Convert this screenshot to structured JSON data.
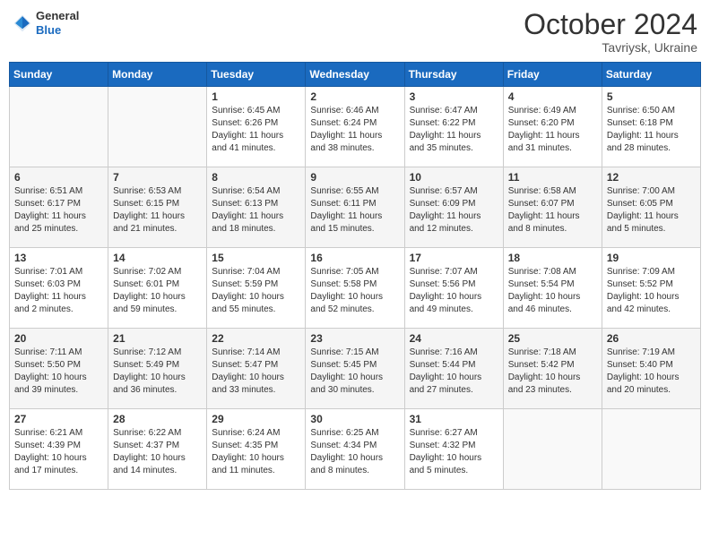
{
  "header": {
    "logo": {
      "general": "General",
      "blue": "Blue"
    },
    "month_year": "October 2024",
    "location": "Tavriysk, Ukraine"
  },
  "weekdays": [
    "Sunday",
    "Monday",
    "Tuesday",
    "Wednesday",
    "Thursday",
    "Friday",
    "Saturday"
  ],
  "weeks": [
    [
      {
        "day": null,
        "sunrise": null,
        "sunset": null,
        "daylight": null
      },
      {
        "day": null,
        "sunrise": null,
        "sunset": null,
        "daylight": null
      },
      {
        "day": "1",
        "sunrise": "Sunrise: 6:45 AM",
        "sunset": "Sunset: 6:26 PM",
        "daylight": "Daylight: 11 hours and 41 minutes."
      },
      {
        "day": "2",
        "sunrise": "Sunrise: 6:46 AM",
        "sunset": "Sunset: 6:24 PM",
        "daylight": "Daylight: 11 hours and 38 minutes."
      },
      {
        "day": "3",
        "sunrise": "Sunrise: 6:47 AM",
        "sunset": "Sunset: 6:22 PM",
        "daylight": "Daylight: 11 hours and 35 minutes."
      },
      {
        "day": "4",
        "sunrise": "Sunrise: 6:49 AM",
        "sunset": "Sunset: 6:20 PM",
        "daylight": "Daylight: 11 hours and 31 minutes."
      },
      {
        "day": "5",
        "sunrise": "Sunrise: 6:50 AM",
        "sunset": "Sunset: 6:18 PM",
        "daylight": "Daylight: 11 hours and 28 minutes."
      }
    ],
    [
      {
        "day": "6",
        "sunrise": "Sunrise: 6:51 AM",
        "sunset": "Sunset: 6:17 PM",
        "daylight": "Daylight: 11 hours and 25 minutes."
      },
      {
        "day": "7",
        "sunrise": "Sunrise: 6:53 AM",
        "sunset": "Sunset: 6:15 PM",
        "daylight": "Daylight: 11 hours and 21 minutes."
      },
      {
        "day": "8",
        "sunrise": "Sunrise: 6:54 AM",
        "sunset": "Sunset: 6:13 PM",
        "daylight": "Daylight: 11 hours and 18 minutes."
      },
      {
        "day": "9",
        "sunrise": "Sunrise: 6:55 AM",
        "sunset": "Sunset: 6:11 PM",
        "daylight": "Daylight: 11 hours and 15 minutes."
      },
      {
        "day": "10",
        "sunrise": "Sunrise: 6:57 AM",
        "sunset": "Sunset: 6:09 PM",
        "daylight": "Daylight: 11 hours and 12 minutes."
      },
      {
        "day": "11",
        "sunrise": "Sunrise: 6:58 AM",
        "sunset": "Sunset: 6:07 PM",
        "daylight": "Daylight: 11 hours and 8 minutes."
      },
      {
        "day": "12",
        "sunrise": "Sunrise: 7:00 AM",
        "sunset": "Sunset: 6:05 PM",
        "daylight": "Daylight: 11 hours and 5 minutes."
      }
    ],
    [
      {
        "day": "13",
        "sunrise": "Sunrise: 7:01 AM",
        "sunset": "Sunset: 6:03 PM",
        "daylight": "Daylight: 11 hours and 2 minutes."
      },
      {
        "day": "14",
        "sunrise": "Sunrise: 7:02 AM",
        "sunset": "Sunset: 6:01 PM",
        "daylight": "Daylight: 10 hours and 59 minutes."
      },
      {
        "day": "15",
        "sunrise": "Sunrise: 7:04 AM",
        "sunset": "Sunset: 5:59 PM",
        "daylight": "Daylight: 10 hours and 55 minutes."
      },
      {
        "day": "16",
        "sunrise": "Sunrise: 7:05 AM",
        "sunset": "Sunset: 5:58 PM",
        "daylight": "Daylight: 10 hours and 52 minutes."
      },
      {
        "day": "17",
        "sunrise": "Sunrise: 7:07 AM",
        "sunset": "Sunset: 5:56 PM",
        "daylight": "Daylight: 10 hours and 49 minutes."
      },
      {
        "day": "18",
        "sunrise": "Sunrise: 7:08 AM",
        "sunset": "Sunset: 5:54 PM",
        "daylight": "Daylight: 10 hours and 46 minutes."
      },
      {
        "day": "19",
        "sunrise": "Sunrise: 7:09 AM",
        "sunset": "Sunset: 5:52 PM",
        "daylight": "Daylight: 10 hours and 42 minutes."
      }
    ],
    [
      {
        "day": "20",
        "sunrise": "Sunrise: 7:11 AM",
        "sunset": "Sunset: 5:50 PM",
        "daylight": "Daylight: 10 hours and 39 minutes."
      },
      {
        "day": "21",
        "sunrise": "Sunrise: 7:12 AM",
        "sunset": "Sunset: 5:49 PM",
        "daylight": "Daylight: 10 hours and 36 minutes."
      },
      {
        "day": "22",
        "sunrise": "Sunrise: 7:14 AM",
        "sunset": "Sunset: 5:47 PM",
        "daylight": "Daylight: 10 hours and 33 minutes."
      },
      {
        "day": "23",
        "sunrise": "Sunrise: 7:15 AM",
        "sunset": "Sunset: 5:45 PM",
        "daylight": "Daylight: 10 hours and 30 minutes."
      },
      {
        "day": "24",
        "sunrise": "Sunrise: 7:16 AM",
        "sunset": "Sunset: 5:44 PM",
        "daylight": "Daylight: 10 hours and 27 minutes."
      },
      {
        "day": "25",
        "sunrise": "Sunrise: 7:18 AM",
        "sunset": "Sunset: 5:42 PM",
        "daylight": "Daylight: 10 hours and 23 minutes."
      },
      {
        "day": "26",
        "sunrise": "Sunrise: 7:19 AM",
        "sunset": "Sunset: 5:40 PM",
        "daylight": "Daylight: 10 hours and 20 minutes."
      }
    ],
    [
      {
        "day": "27",
        "sunrise": "Sunrise: 6:21 AM",
        "sunset": "Sunset: 4:39 PM",
        "daylight": "Daylight: 10 hours and 17 minutes."
      },
      {
        "day": "28",
        "sunrise": "Sunrise: 6:22 AM",
        "sunset": "Sunset: 4:37 PM",
        "daylight": "Daylight: 10 hours and 14 minutes."
      },
      {
        "day": "29",
        "sunrise": "Sunrise: 6:24 AM",
        "sunset": "Sunset: 4:35 PM",
        "daylight": "Daylight: 10 hours and 11 minutes."
      },
      {
        "day": "30",
        "sunrise": "Sunrise: 6:25 AM",
        "sunset": "Sunset: 4:34 PM",
        "daylight": "Daylight: 10 hours and 8 minutes."
      },
      {
        "day": "31",
        "sunrise": "Sunrise: 6:27 AM",
        "sunset": "Sunset: 4:32 PM",
        "daylight": "Daylight: 10 hours and 5 minutes."
      },
      {
        "day": null,
        "sunrise": null,
        "sunset": null,
        "daylight": null
      },
      {
        "day": null,
        "sunrise": null,
        "sunset": null,
        "daylight": null
      }
    ]
  ]
}
